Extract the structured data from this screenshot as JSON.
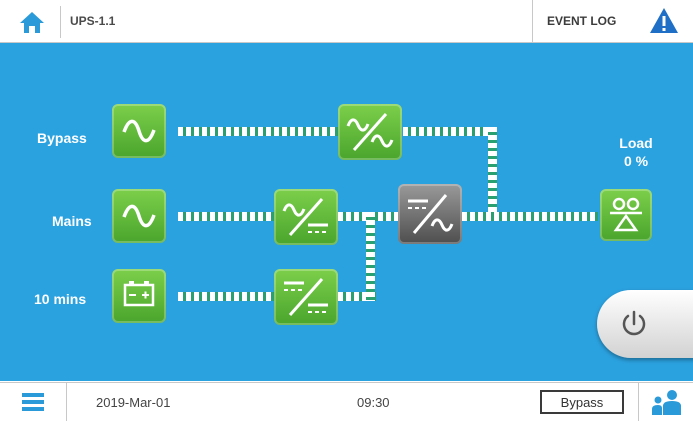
{
  "header": {
    "device_name": "UPS-1.1",
    "event_log_label": "EVENT LOG",
    "home_icon": "home-icon",
    "warning_icon": "warning-triangle-icon"
  },
  "diagram": {
    "rows": [
      {
        "label": "Bypass",
        "icon": "ac-sine-icon"
      },
      {
        "label": "Mains",
        "icon": "ac-sine-icon"
      },
      {
        "label": "10 mins",
        "icon": "battery-icon"
      }
    ],
    "bypass_switch_icon": "ac-ac-converter-icon",
    "rectifier_icon": "ac-dc-rectifier-icon",
    "charger_icon": "dc-dc-converter-icon",
    "inverter_icon": "dc-ac-inverter-icon",
    "load_icon": "load-icon",
    "load_label": "Load",
    "load_value": "0 %",
    "power_icon": "power-icon"
  },
  "footer": {
    "menu_icon": "menu-icon",
    "date": "2019-Mar-01",
    "time": "09:30",
    "mode": "Bypass",
    "user_icon": "users-icon"
  },
  "colors": {
    "background": "#2ba2e0",
    "module_green": "#5cb83a",
    "module_gray": "#6e6e6e",
    "flow_arrows": "#2aa070",
    "warning_blue": "#1f6fc7"
  }
}
